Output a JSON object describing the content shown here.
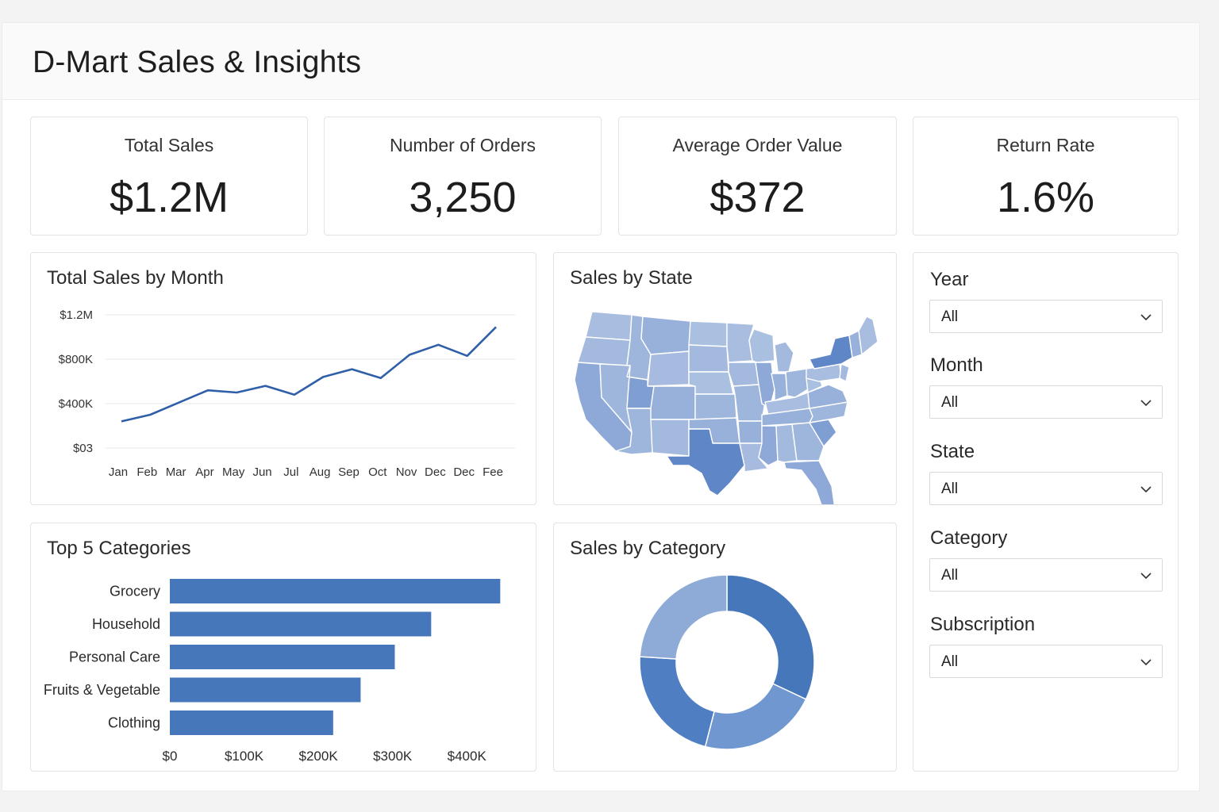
{
  "header": {
    "title": "D-Mart Sales & Insights"
  },
  "kpis": [
    {
      "label": "Total Sales",
      "value": "$1.2M"
    },
    {
      "label": "Number of Orders",
      "value": "3,250"
    },
    {
      "label": "Average Order Value",
      "value": "$372"
    },
    {
      "label": "Return Rate",
      "value": "1.6%"
    }
  ],
  "panels": {
    "line_title": "Total Sales by Month",
    "map_title": "Sales by State",
    "bar_title": "Top 5 Categories",
    "donut_title": "Sales by Category"
  },
  "filters": [
    {
      "label": "Year",
      "value": "All"
    },
    {
      "label": "Month",
      "value": "All"
    },
    {
      "label": "State",
      "value": "All"
    },
    {
      "label": "Category",
      "value": "All"
    },
    {
      "label": "Subscription",
      "value": "All"
    }
  ],
  "colors": {
    "primary": "#4677ba",
    "light": "#8eaad6",
    "mid": "#6c8fcb",
    "line": "#2f5fa8"
  },
  "chart_data": [
    {
      "type": "line",
      "title": "Total Sales by Month",
      "x": [
        "Jan",
        "Feb",
        "Mar",
        "Apr",
        "May",
        "Jun",
        "Jul",
        "Aug",
        "Sep",
        "Oct",
        "Nov",
        "Dec",
        "Dec",
        "Fee"
      ],
      "values": [
        240000,
        300000,
        410000,
        520000,
        500000,
        560000,
        480000,
        640000,
        710000,
        630000,
        840000,
        930000,
        830000,
        1090000
      ],
      "y_ticks": [
        {
          "v": 0,
          "label": "$03"
        },
        {
          "v": 400000,
          "label": "$400K"
        },
        {
          "v": 800000,
          "label": "$800K"
        },
        {
          "v": 1200000,
          "label": "$1.2M"
        }
      ],
      "ylim": [
        0,
        1200000
      ],
      "grid": true
    },
    {
      "type": "bar",
      "orientation": "horizontal",
      "title": "Top 5 Categories",
      "categories": [
        "Grocery",
        "Household",
        "Personal Care",
        "Fruits & Vegetable",
        "Clothing"
      ],
      "values": [
        445000,
        352000,
        303000,
        257000,
        220000
      ],
      "x_ticks": [
        {
          "v": 0,
          "label": "$0"
        },
        {
          "v": 100000,
          "label": "$100K"
        },
        {
          "v": 200000,
          "label": "$200K"
        },
        {
          "v": 300000,
          "label": "$300K"
        },
        {
          "v": 400000,
          "label": "$400K"
        }
      ],
      "xlim": [
        0,
        450000
      ]
    },
    {
      "type": "pie",
      "style": "donut",
      "title": "Sales by Category",
      "values": [
        32,
        22,
        22,
        24
      ],
      "colors": [
        "#4677ba",
        "#7097cf",
        "#4f7fc2",
        "#8eaad6"
      ]
    }
  ]
}
